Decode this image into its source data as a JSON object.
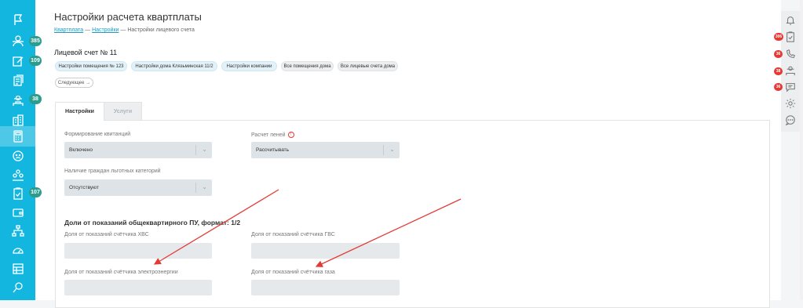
{
  "header": {
    "title": "Настройки расчета квартплаты",
    "breadcrumb": [
      {
        "label": "Квартплата"
      },
      {
        "label": "Настройки"
      },
      {
        "label": "Настройки лицевого счета"
      }
    ],
    "separator": "—"
  },
  "account": {
    "title": "Лицевой счет № 11",
    "chips": [
      {
        "label": "Настройки помещения № 123"
      },
      {
        "label": "Настройки дома Клязьминская 11/2"
      },
      {
        "label": "Настройки компании"
      },
      {
        "label": "Все помещения дома"
      },
      {
        "label": "Все лицевые счета дома"
      }
    ],
    "next_label": "Следующее →"
  },
  "tabs": [
    {
      "label": "Настройки",
      "active": true
    },
    {
      "label": "Услуги",
      "active": false
    }
  ],
  "form": {
    "receipts": {
      "label": "Формирование квитанций",
      "value": "Включено"
    },
    "penalties": {
      "label": "Расчет пеней",
      "value": "Рассчитывать",
      "info_icon": "!"
    },
    "benefits": {
      "label": "Наличие граждан льготных категорий",
      "value": "Отсутствуют"
    },
    "section_title": "Доли от показаний общеквартирного ПУ, формат: 1/2",
    "fields": {
      "cold_water": "Доля от показаний счётчика ХВС",
      "hot_water": "Доля от показаний счётчика ГВС",
      "electricity": "Доля от показаний счётчика электроэнергии",
      "gas": "Доля от показаний счётчика газа"
    }
  },
  "sidebar": {
    "items": [
      {
        "icon": "flag-icon"
      },
      {
        "icon": "users-icon",
        "badge": "385"
      },
      {
        "icon": "edit-icon",
        "badge": "109"
      },
      {
        "icon": "documents-icon"
      },
      {
        "icon": "engineer-icon",
        "badge": "38"
      },
      {
        "icon": "building-icon"
      },
      {
        "icon": "calculator-icon",
        "active": true
      },
      {
        "icon": "smile-icon"
      },
      {
        "icon": "group-icon"
      },
      {
        "icon": "clipboard-check-icon",
        "badge": "107"
      },
      {
        "icon": "wallet-icon"
      },
      {
        "icon": "hierarchy-icon"
      },
      {
        "icon": "meter-icon"
      },
      {
        "icon": "table-icon"
      },
      {
        "icon": "location-icon"
      }
    ]
  },
  "right_panel": {
    "items": [
      {
        "icon": "bell-icon"
      },
      {
        "icon": "clipboard-icon",
        "badge": "306"
      },
      {
        "icon": "phone-icon",
        "badge": "36"
      },
      {
        "icon": "worker-icon",
        "badge": "38"
      },
      {
        "icon": "message-icon",
        "badge": "36"
      },
      {
        "icon": "settings-icon"
      },
      {
        "icon": "chat-icon"
      }
    ]
  },
  "colors": {
    "sidebar": "#12b6df",
    "sidebar_badge": "#2a9d8f",
    "alert_badge": "#e53935",
    "link": "#1a9cc4",
    "annotation_arrow": "#e53935"
  }
}
